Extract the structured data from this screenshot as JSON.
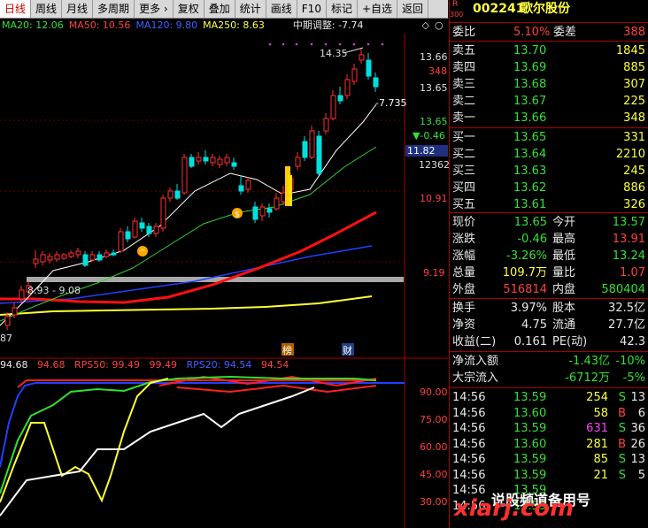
{
  "toolbar": {
    "tabs": [
      "日线",
      "周线",
      "月线",
      "多周期",
      "更多"
    ],
    "more_arrow": "›",
    "buttons": [
      "复权",
      "叠加",
      "统计",
      "画线",
      "F10",
      "标记",
      "+自选",
      "返回"
    ]
  },
  "ma_bar": {
    "ma20": "MA20: 12.06",
    "ma50": "MA50: 10.56",
    "ma120": "MA120: 9.80",
    "ma250": "MA250: 8.63",
    "adjust": "中期调整: -7.74"
  },
  "colors": {
    "up": "#ff3030",
    "down": "#00e0e0",
    "ma20": "#40e040",
    "ma50": "#ff2020",
    "ma120": "#2040ff",
    "ma250": "#ffff30",
    "price_line": "#ffffff"
  },
  "chart_labels": {
    "high": "14.35",
    "low": "8.93 - 9.08",
    "current_marker": "-7.735",
    "left_bottom": "87",
    "tag_bang": "榜",
    "tag_cai": "财"
  },
  "price_axis": {
    "p1": "13.66",
    "p2": "348",
    "p3": "13.65",
    "p4": "13.65",
    "change": "▼-0.46",
    "box": "11.82",
    "vol": "12362",
    "p5": "10.91",
    "p6": "9.19"
  },
  "rps": {
    "v1": "94.68",
    "v2": "94.68",
    "rps50_label": "RPS50: 99.49",
    "rps50_v": "99.49",
    "rps20_label": "RPS20: 94.54",
    "rps20_v": "94.54",
    "axis": [
      "90.00",
      "75.00",
      "60.00",
      "45.00",
      "30.00"
    ]
  },
  "stock": {
    "flag_r": "R",
    "flag_num": "300",
    "code": "002241",
    "name": "歌尔股份"
  },
  "weibi": {
    "l1": "委比",
    "v1": "5.10%",
    "l2": "委差",
    "v2": "388"
  },
  "asks": [
    {
      "label": "卖五",
      "price": "13.70",
      "vol": "1845"
    },
    {
      "label": "卖四",
      "price": "13.69",
      "vol": "885"
    },
    {
      "label": "卖三",
      "price": "13.68",
      "vol": "307"
    },
    {
      "label": "卖二",
      "price": "13.67",
      "vol": "225"
    },
    {
      "label": "卖一",
      "price": "13.66",
      "vol": "348"
    }
  ],
  "bids": [
    {
      "label": "买一",
      "price": "13.65",
      "vol": "331"
    },
    {
      "label": "买二",
      "price": "13.64",
      "vol": "2210"
    },
    {
      "label": "买三",
      "price": "13.63",
      "vol": "245"
    },
    {
      "label": "买四",
      "price": "13.62",
      "vol": "886"
    },
    {
      "label": "买五",
      "price": "13.61",
      "vol": "326"
    }
  ],
  "quote": [
    {
      "l1": "现价",
      "v1": "13.65",
      "l2": "今开",
      "v2": "13.57"
    },
    {
      "l1": "涨跌",
      "v1": "-0.46",
      "l2": "最高",
      "v2": "13.91"
    },
    {
      "l1": "涨幅",
      "v1": "-3.26%",
      "l2": "最低",
      "v2": "13.24"
    },
    {
      "l1": "总量",
      "v1": "109.7万",
      "l2": "量比",
      "v2": "1.07"
    },
    {
      "l1": "外盘",
      "v1": "516814",
      "l2": "内盘",
      "v2": "580404"
    }
  ],
  "fin": [
    {
      "l1": "换手",
      "v1": "3.97%",
      "l2": "股本",
      "v2": "32.5亿"
    },
    {
      "l1": "净资",
      "v1": "4.75",
      "l2": "流通",
      "v2": "27.7亿"
    },
    {
      "l1": "收益(二)",
      "v1": "0.161",
      "l2": "PE(动)",
      "v2": "42.3"
    }
  ],
  "flow": [
    {
      "label": "净流入额",
      "v1": "-1.43亿",
      "v2": "-10%"
    },
    {
      "label": "大宗流入",
      "v1": "-6712万",
      "v2": "-5%"
    }
  ],
  "ticks": [
    {
      "time": "14:56",
      "price": "13.59",
      "vol": "254",
      "side": "S",
      "n": "13"
    },
    {
      "time": "14:56",
      "price": "13.60",
      "vol": "58",
      "side": "B",
      "n": "6"
    },
    {
      "time": "14:56",
      "price": "13.59",
      "vol": "631",
      "side": "S",
      "n": "36"
    },
    {
      "time": "14:56",
      "price": "13.60",
      "vol": "281",
      "side": "B",
      "n": "26"
    },
    {
      "time": "14:56",
      "price": "13.59",
      "vol": "85",
      "side": "S",
      "n": "13"
    },
    {
      "time": "14:56",
      "price": "13.59",
      "vol": "21",
      "side": "S",
      "n": "5"
    },
    {
      "time": "14:56",
      "price": "13.59",
      "vol": "",
      "side": "",
      "n": ""
    },
    {
      "time": "14:56",
      "price": "13.59",
      "vol": "",
      "side": "",
      "n": ""
    }
  ],
  "watermark": {
    "text1": "说股频道备用号",
    "text2": "xiarj.com"
  }
}
